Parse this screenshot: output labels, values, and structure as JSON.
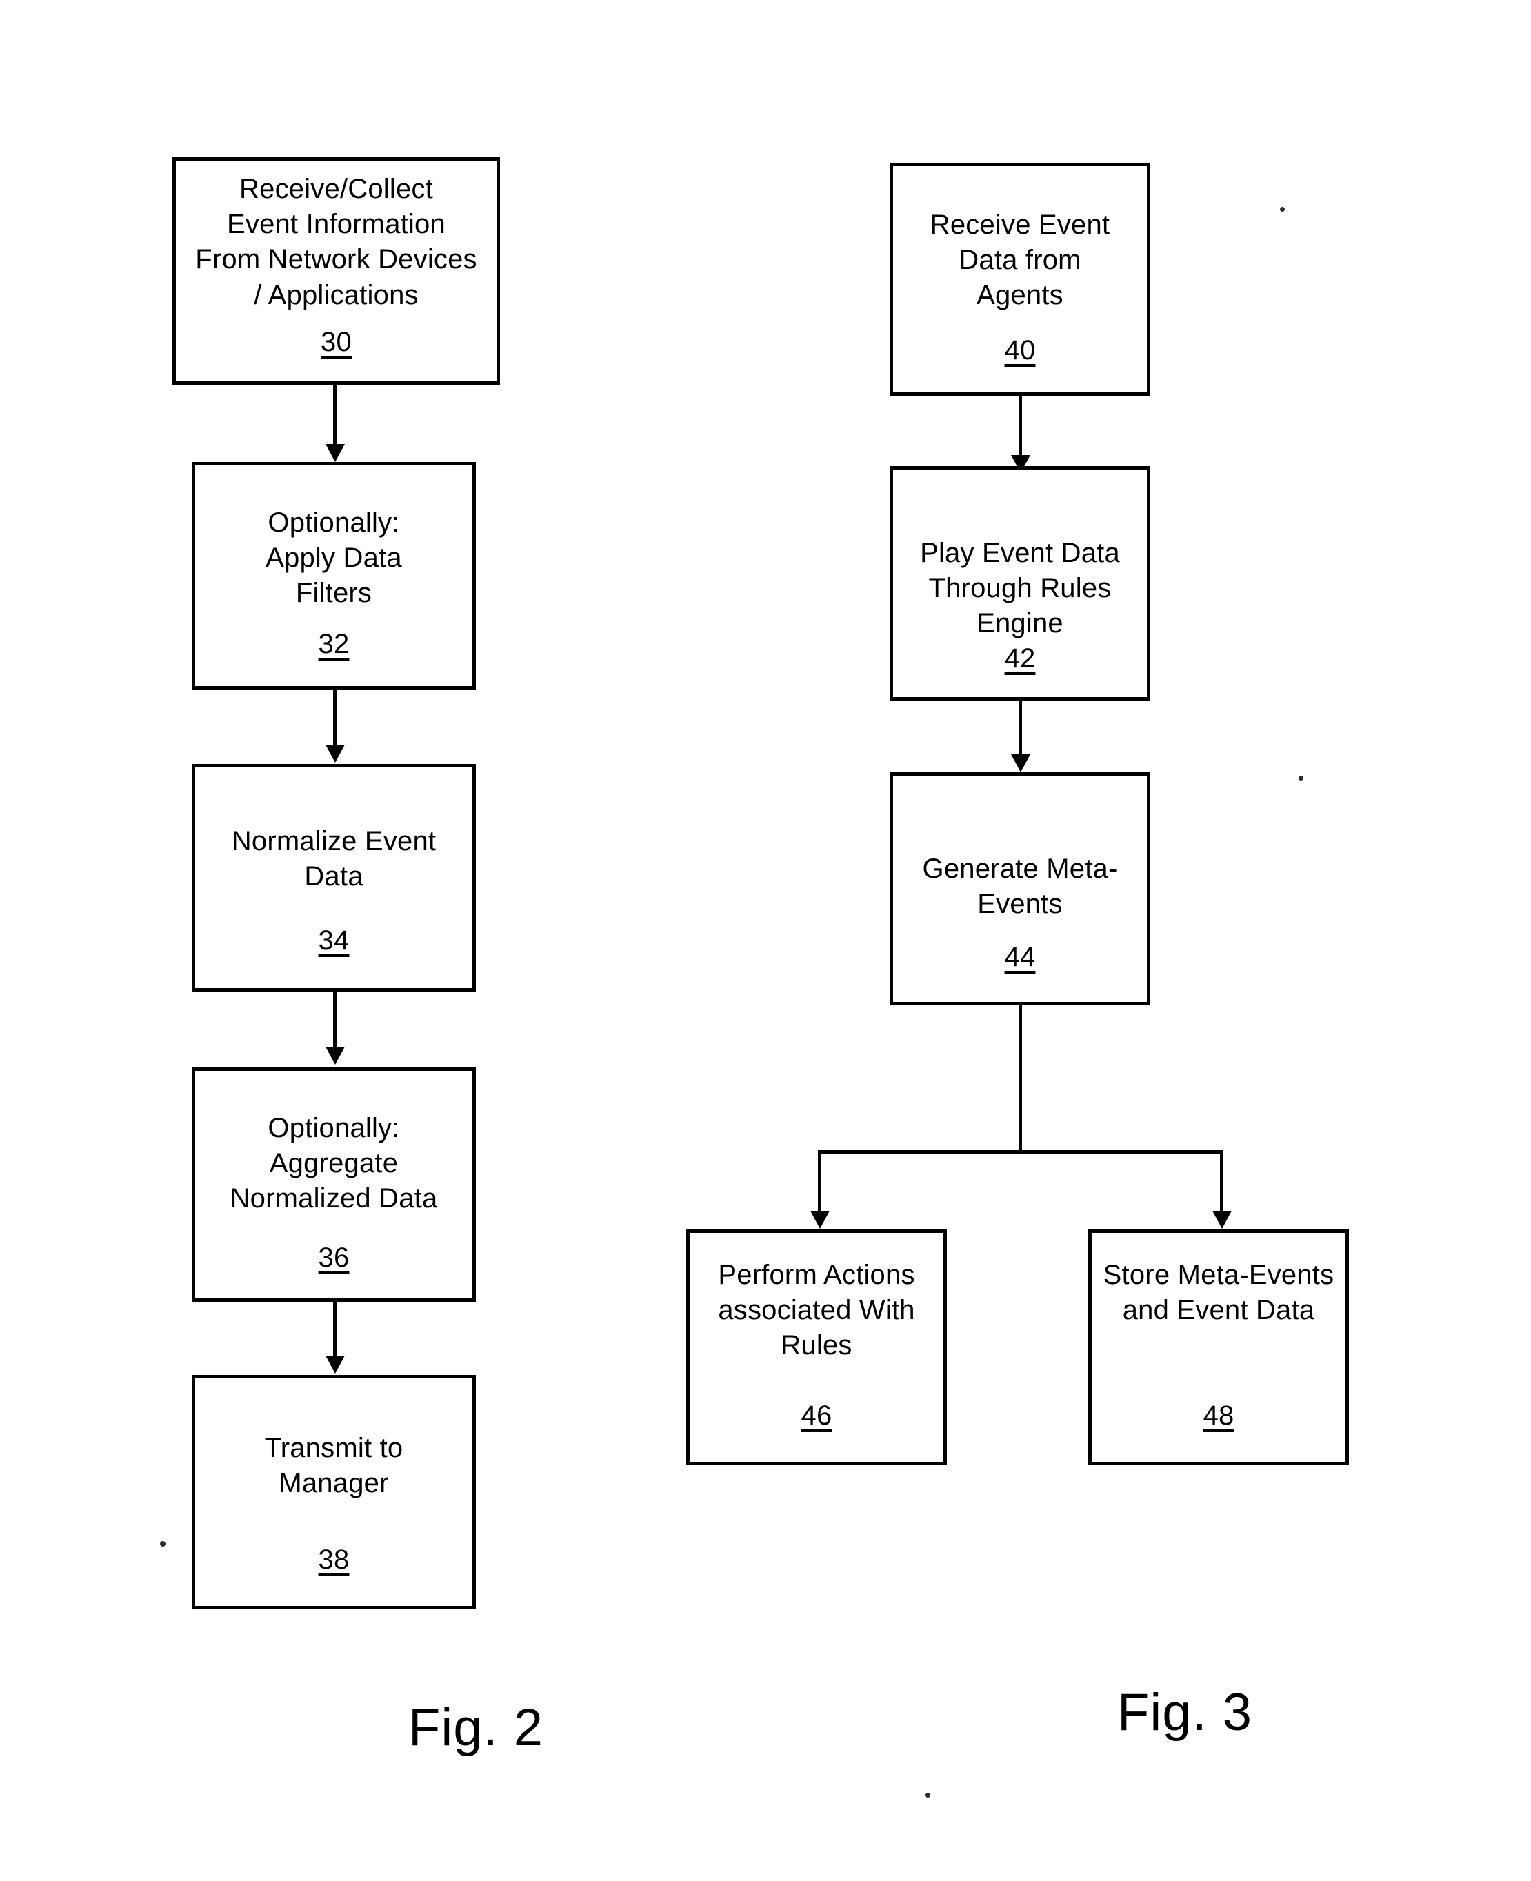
{
  "document": {
    "type": "patent-figure-sheet",
    "figures": [
      {
        "caption": "Fig. 2",
        "steps": [
          {
            "ref": "30",
            "text": "Receive/Collect\nEvent Information\nFrom Network Devices\n/ Applications"
          },
          {
            "ref": "32",
            "text": "Optionally:\nApply Data\nFilters"
          },
          {
            "ref": "34",
            "text": "Normalize Event\nData"
          },
          {
            "ref": "36",
            "text": "Optionally:\nAggregate\nNormalized Data"
          },
          {
            "ref": "38",
            "text": "Transmit to\nManager"
          }
        ]
      },
      {
        "caption": "Fig. 3",
        "steps": [
          {
            "ref": "40",
            "text": "Receive Event\nData from\nAgents"
          },
          {
            "ref": "42",
            "text": "Play Event Data\nThrough Rules\nEngine"
          },
          {
            "ref": "44",
            "text": "Generate Meta-\nEvents"
          },
          {
            "ref": "46",
            "text": "Perform Actions\nassociated With\nRules"
          },
          {
            "ref": "48",
            "text": "Store Meta-Events\nand Event Data"
          }
        ]
      }
    ]
  },
  "colors": {
    "ink": "#000000",
    "paper": "#ffffff"
  }
}
